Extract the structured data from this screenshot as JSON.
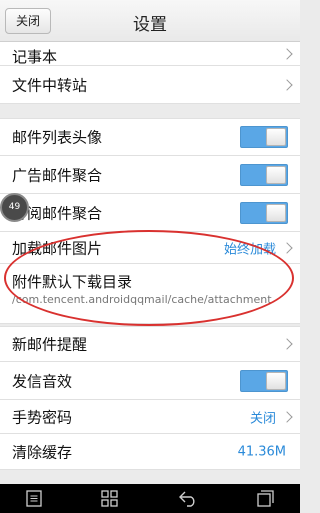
{
  "header": {
    "close_label": "关闭",
    "title": "设置"
  },
  "rows": {
    "notepad": {
      "label": "记事本"
    },
    "transfer": {
      "label": "文件中转站"
    },
    "avatar": {
      "label": "邮件列表头像",
      "enabled": true
    },
    "ad_aggregate": {
      "label": "广告邮件聚合",
      "enabled": true
    },
    "subscribe_aggregate": {
      "label": "订阅邮件聚合",
      "enabled": true
    },
    "load_images": {
      "label": "加载邮件图片",
      "value": "始终加载"
    },
    "attachment_dir": {
      "label": "附件默认下载目录",
      "path": "/com.tencent.androidqqmail/cache/attachment"
    },
    "new_mail": {
      "label": "新邮件提醒"
    },
    "send_sound": {
      "label": "发信音效",
      "enabled": true
    },
    "gesture": {
      "label": "手势密码",
      "value": "关闭"
    },
    "cache": {
      "label": "清除缓存",
      "value": "41.36M"
    }
  },
  "overlay": {
    "badge_text": "49"
  },
  "colors": {
    "accent": "#2a8ad9",
    "toggle_on": "#5aa7e6",
    "highlight_circle": "#d9312f"
  },
  "nav_icons": [
    "menu-icon",
    "app-grid-icon",
    "back-icon",
    "recent-apps-icon"
  ]
}
